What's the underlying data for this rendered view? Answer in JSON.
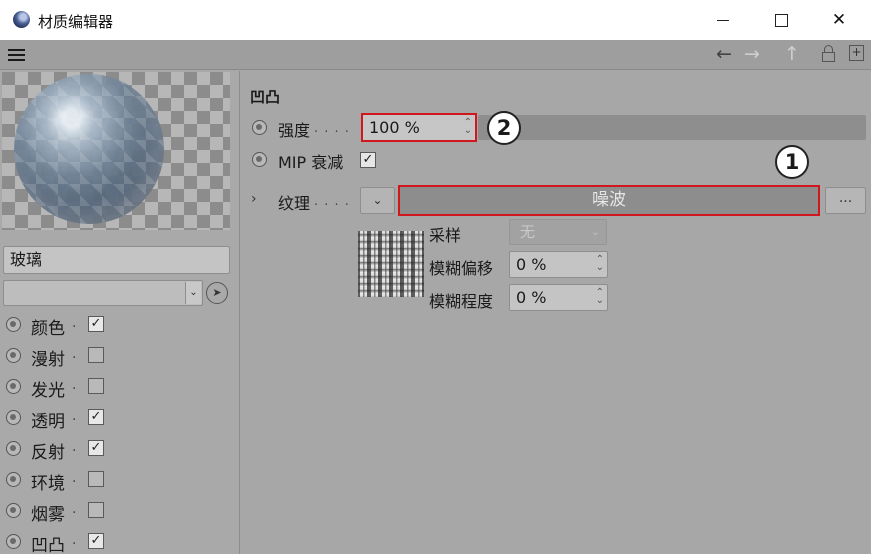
{
  "window": {
    "title": "材质编辑器",
    "minimize": "—",
    "maximize": "☐",
    "close": "✕"
  },
  "toolbar": {
    "back": "←",
    "forward": "→",
    "up": "↑",
    "new_window": "+"
  },
  "left": {
    "material_name": "玻璃",
    "dropdown_value": "",
    "channels": [
      {
        "label": "颜色",
        "dots": ". ",
        "checked": true
      },
      {
        "label": "漫射",
        "dots": ". ",
        "checked": false
      },
      {
        "label": "发光",
        "dots": ". ",
        "checked": false
      },
      {
        "label": "透明",
        "dots": ". ",
        "checked": true
      },
      {
        "label": "反射",
        "dots": ". ",
        "checked": true
      },
      {
        "label": "环境",
        "dots": ". ",
        "checked": false
      },
      {
        "label": "烟雾",
        "dots": ". ",
        "checked": false
      },
      {
        "label": "凹凸",
        "dots": ". ",
        "checked": true
      }
    ]
  },
  "bump": {
    "section_title": "凹凸",
    "strength_label": "强度",
    "strength_dots": ". . . .",
    "strength_value": "100 %",
    "mip_label": "MIP 衰减",
    "mip_checked": true,
    "texture_label": "纹理",
    "texture_dots": ". . . .",
    "texture_value": "噪波",
    "more_label": "...",
    "sampling_label": "采样",
    "sampling_value": "无",
    "blur_offset_label": "模糊偏移",
    "blur_offset_value": "0 %",
    "blur_scale_label": "模糊程度",
    "blur_scale_value": "0 %"
  },
  "callouts": {
    "one": "1",
    "two": "2"
  },
  "colors": {
    "highlight": "#d1171e",
    "panel": "#a7a7a7"
  }
}
